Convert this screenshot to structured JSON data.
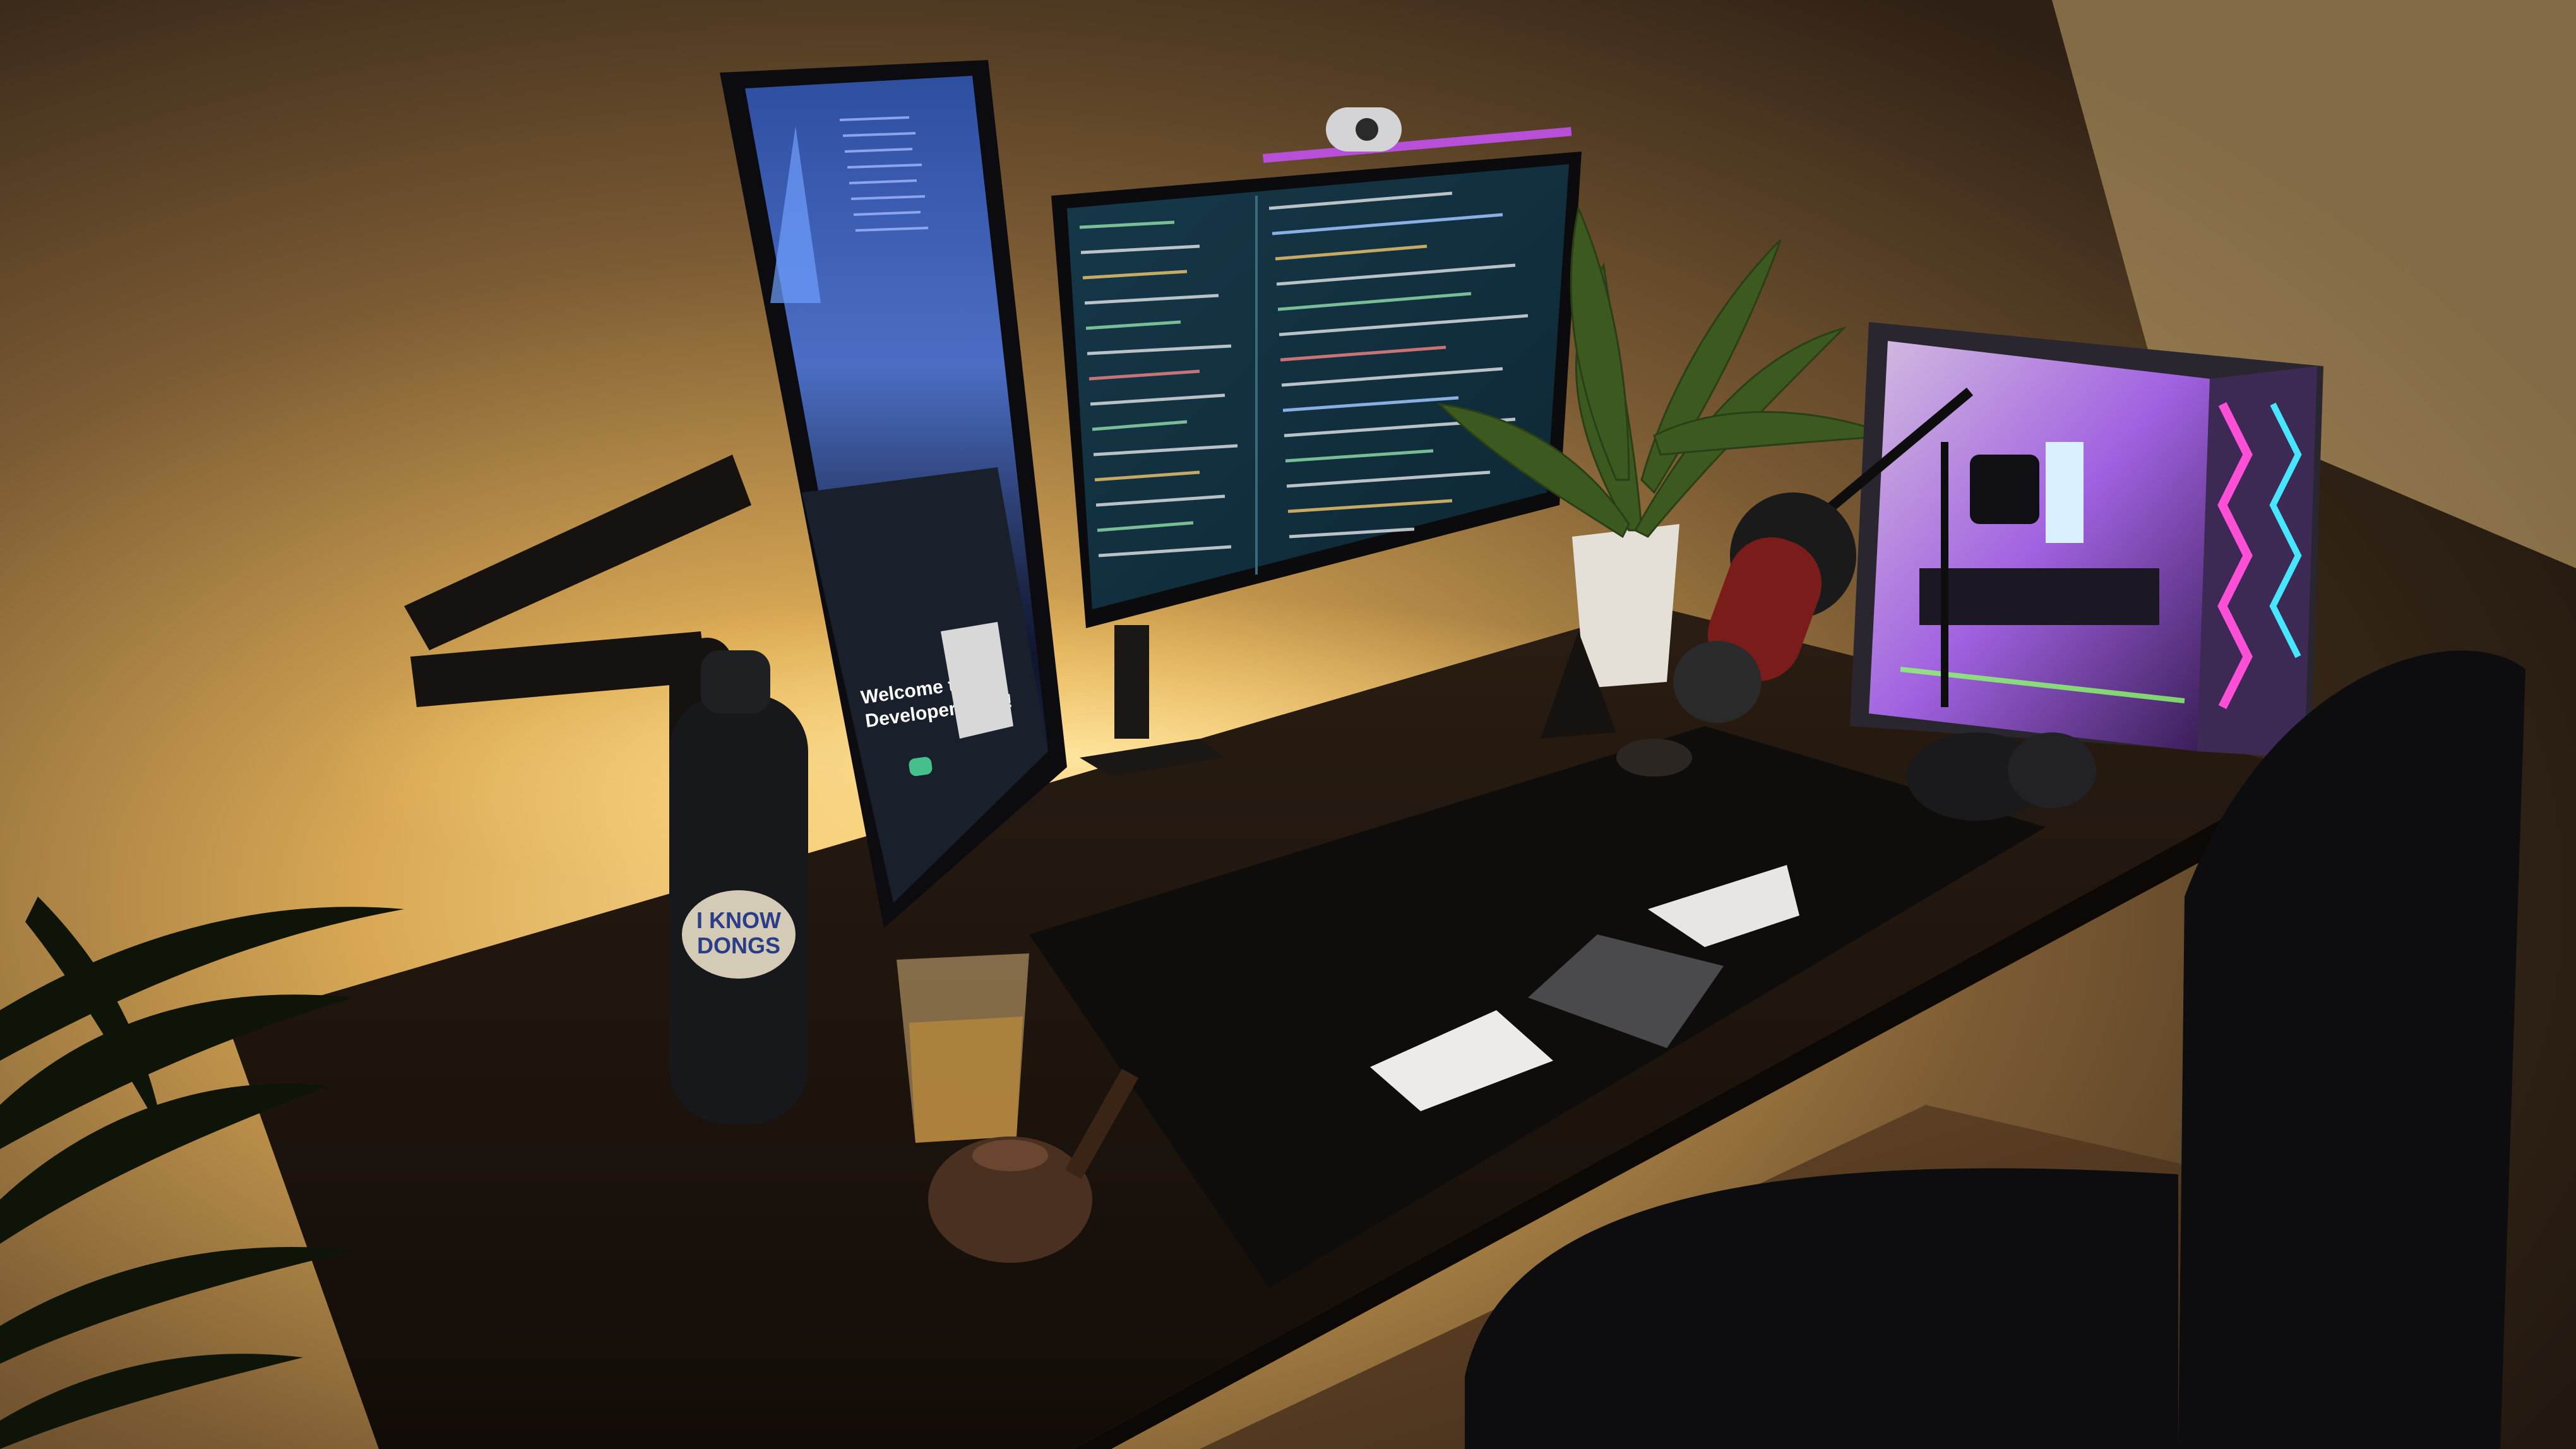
{
  "photo": {
    "vertical_monitor": {
      "browser_heading_line1": "Welcome to my",
      "browser_heading_line2": "Developer Page!"
    },
    "bottle": {
      "label_line1": "I KNOW",
      "label_line2": "DONGS"
    },
    "colors": {
      "wall": "#6e5330",
      "wall_glow": "#f2c66e",
      "desk": "#1c140d",
      "desk_mat": "#0e0d0c",
      "terminal_bg": "#12323f",
      "vertical_screen_top": "#3b5aa4",
      "rgb_pink": "#ff4fd6",
      "rgb_cyan": "#46e6ff",
      "rgb_green": "#8cff6e"
    }
  }
}
